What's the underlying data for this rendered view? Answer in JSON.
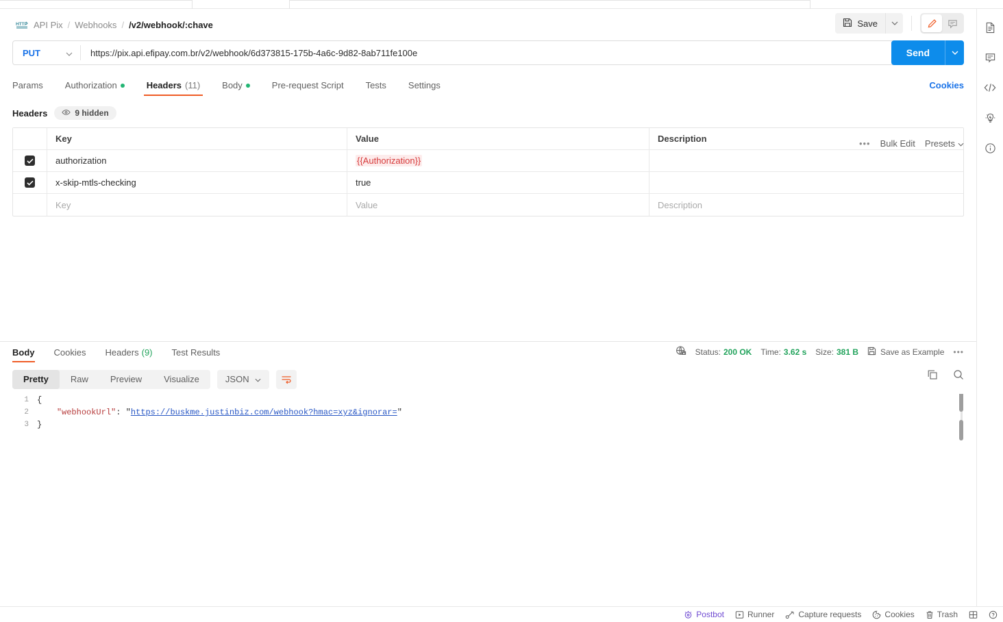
{
  "breadcrumb": {
    "icon": "http-icon",
    "parts": [
      "API Pix",
      "Webhooks"
    ],
    "separator": "/",
    "current": "/v2/webhook/:chave"
  },
  "header_actions": {
    "save_label": "Save",
    "save_caret": "chevron-down-icon",
    "edit_icon": "pencil-icon",
    "comment_icon": "comment-icon"
  },
  "request": {
    "method": "PUT",
    "method_caret": "chevron-down-icon",
    "url": "https://pix.api.efipay.com.br/v2/webhook/6d373815-175b-4a6c-9d82-8ab711fe100e",
    "send_label": "Send",
    "send_caret": "chevron-down-icon",
    "cookies_link": "Cookies",
    "tabs": [
      {
        "label": "Params",
        "badge": "",
        "dot": false,
        "active": false
      },
      {
        "label": "Authorization",
        "badge": "",
        "dot": true,
        "active": false
      },
      {
        "label": "Headers",
        "badge": "(11)",
        "dot": false,
        "active": true
      },
      {
        "label": "Body",
        "badge": "",
        "dot": true,
        "active": false
      },
      {
        "label": "Pre-request Script",
        "badge": "",
        "dot": false,
        "active": false
      },
      {
        "label": "Tests",
        "badge": "",
        "dot": false,
        "active": false
      },
      {
        "label": "Settings",
        "badge": "",
        "dot": false,
        "active": false
      }
    ]
  },
  "headers_section": {
    "title": "Headers",
    "hidden_pill": "9 hidden",
    "hidden_pill_icon": "eye-icon",
    "actions": {
      "more_icon": "ellipsis-icon",
      "bulk_edit": "Bulk Edit",
      "presets": "Presets",
      "presets_caret": "chevron-down-icon"
    },
    "columns": {
      "key": "Key",
      "value": "Value",
      "description": "Description"
    },
    "rows": [
      {
        "checked": true,
        "key": "authorization",
        "value": "{{Authorization}}",
        "value_unresolved": true,
        "description": ""
      },
      {
        "checked": true,
        "key": "x-skip-mtls-checking",
        "value": "true",
        "value_unresolved": false,
        "description": ""
      }
    ],
    "new_row": {
      "key_placeholder": "Key",
      "value_placeholder": "Value",
      "description_placeholder": "Description"
    }
  },
  "response": {
    "tabs": [
      {
        "label": "Body",
        "badge": "",
        "active": true
      },
      {
        "label": "Cookies",
        "badge": "",
        "active": false
      },
      {
        "label": "Headers",
        "badge": "(9)",
        "active": false
      },
      {
        "label": "Test Results",
        "badge": "",
        "active": false
      }
    ],
    "meta": {
      "shield_icon": "globe-lock-icon",
      "status_label": "Status:",
      "status_value": "200 OK",
      "time_label": "Time:",
      "time_value": "3.62 s",
      "size_label": "Size:",
      "size_value": "381 B",
      "save_example_icon": "save-icon",
      "save_example": "Save as Example",
      "more_icon": "ellipsis-icon"
    },
    "toolbar": {
      "formats": [
        {
          "label": "Pretty",
          "active": true
        },
        {
          "label": "Raw",
          "active": false
        },
        {
          "label": "Preview",
          "active": false
        },
        {
          "label": "Visualize",
          "active": false
        }
      ],
      "language": "JSON",
      "language_caret": "chevron-down-icon",
      "wrap_icon": "word-wrap-icon",
      "copy_icon": "copy-icon",
      "search_icon": "search-icon"
    },
    "body_lines": [
      {
        "number": "1",
        "segments": [
          {
            "text": "{",
            "style": "punct"
          }
        ]
      },
      {
        "number": "2",
        "segments": [
          {
            "text": "    ",
            "style": "punct"
          },
          {
            "text": "\"webhookUrl\"",
            "style": "key"
          },
          {
            "text": ": ",
            "style": "punct"
          },
          {
            "text": "\"",
            "style": "punct"
          },
          {
            "text": "https://buskme.justinbiz.com/webhook?hmac=xyz&ignorar=",
            "style": "link"
          },
          {
            "text": "\"",
            "style": "punct"
          }
        ]
      },
      {
        "number": "3",
        "segments": [
          {
            "text": "}",
            "style": "punct"
          }
        ]
      }
    ]
  },
  "right_rail": [
    {
      "icon": "document-icon"
    },
    {
      "icon": "comment-icon"
    },
    {
      "icon": "code-icon"
    },
    {
      "icon": "lightbulb-icon"
    },
    {
      "icon": "info-icon"
    }
  ],
  "footer": [
    {
      "label": "Postbot",
      "icon": "postbot-icon"
    },
    {
      "label": "Runner",
      "icon": "runner-icon"
    },
    {
      "label": "Capture requests",
      "icon": "capture-icon"
    },
    {
      "label": "Cookies",
      "icon": "cookie-icon"
    },
    {
      "label": "Trash",
      "icon": "trash-icon"
    },
    {
      "label": "",
      "icon": "layout-icon"
    },
    {
      "label": "",
      "icon": "help-icon"
    }
  ],
  "colors": {
    "accent_orange": "#ef5b25",
    "send_blue": "#0d8ceb",
    "link_blue": "#1a73e8",
    "success_green": "#22a35c",
    "var_red": "#d63a3a",
    "postbot_purple": "#6f4ad2"
  }
}
